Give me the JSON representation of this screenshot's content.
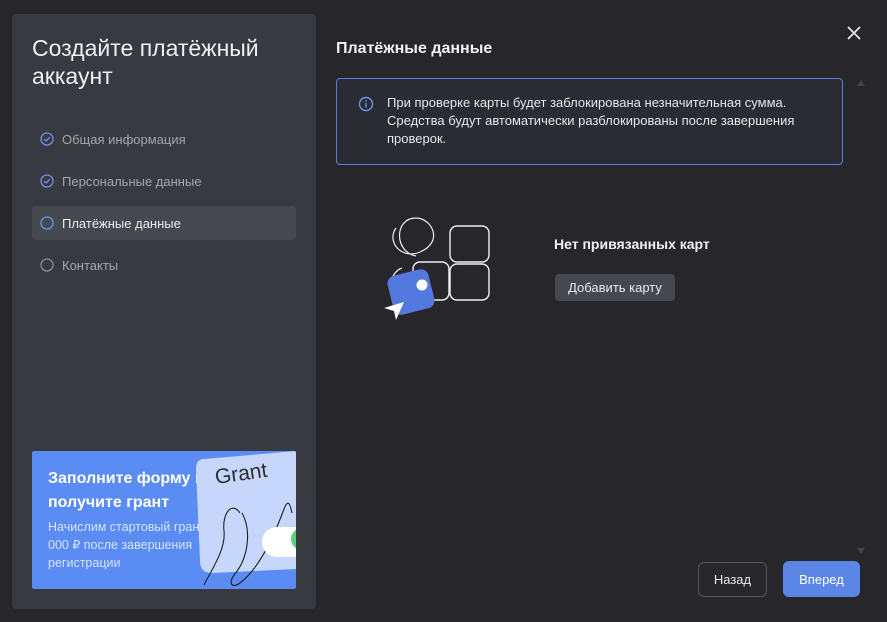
{
  "sidebar": {
    "title": "Создайте платёжный аккаунт",
    "steps": [
      {
        "label": "Общая информация",
        "state": "done"
      },
      {
        "label": "Персональные данные",
        "state": "done"
      },
      {
        "label": "Платёжные данные",
        "state": "current"
      },
      {
        "label": "Контакты",
        "state": "pending"
      }
    ],
    "promo": {
      "title": "Заполните форму и получите грант",
      "text": "Начислим стартовый грант 4 000 ₽ после завершения регистрации",
      "card_label": "Grant"
    }
  },
  "main": {
    "title": "Платёжные данные",
    "info": "При проверке карты будет заблокирована незначительная сумма. Средства будут автоматически разблокированы после завершения проверок.",
    "empty_title": "Нет привязанных карт",
    "add_card_label": "Добавить карту"
  },
  "footer": {
    "back_label": "Назад",
    "next_label": "Вперед"
  },
  "icons": {
    "close": "close-icon",
    "info": "info-icon",
    "step_done": "check-circle-icon",
    "step_pending": "circle-icon"
  },
  "colors": {
    "accent": "#5b86e6",
    "sidebar_bg": "#383a42",
    "page_bg": "#27262b",
    "promo_bg": "#5a8cf4"
  }
}
